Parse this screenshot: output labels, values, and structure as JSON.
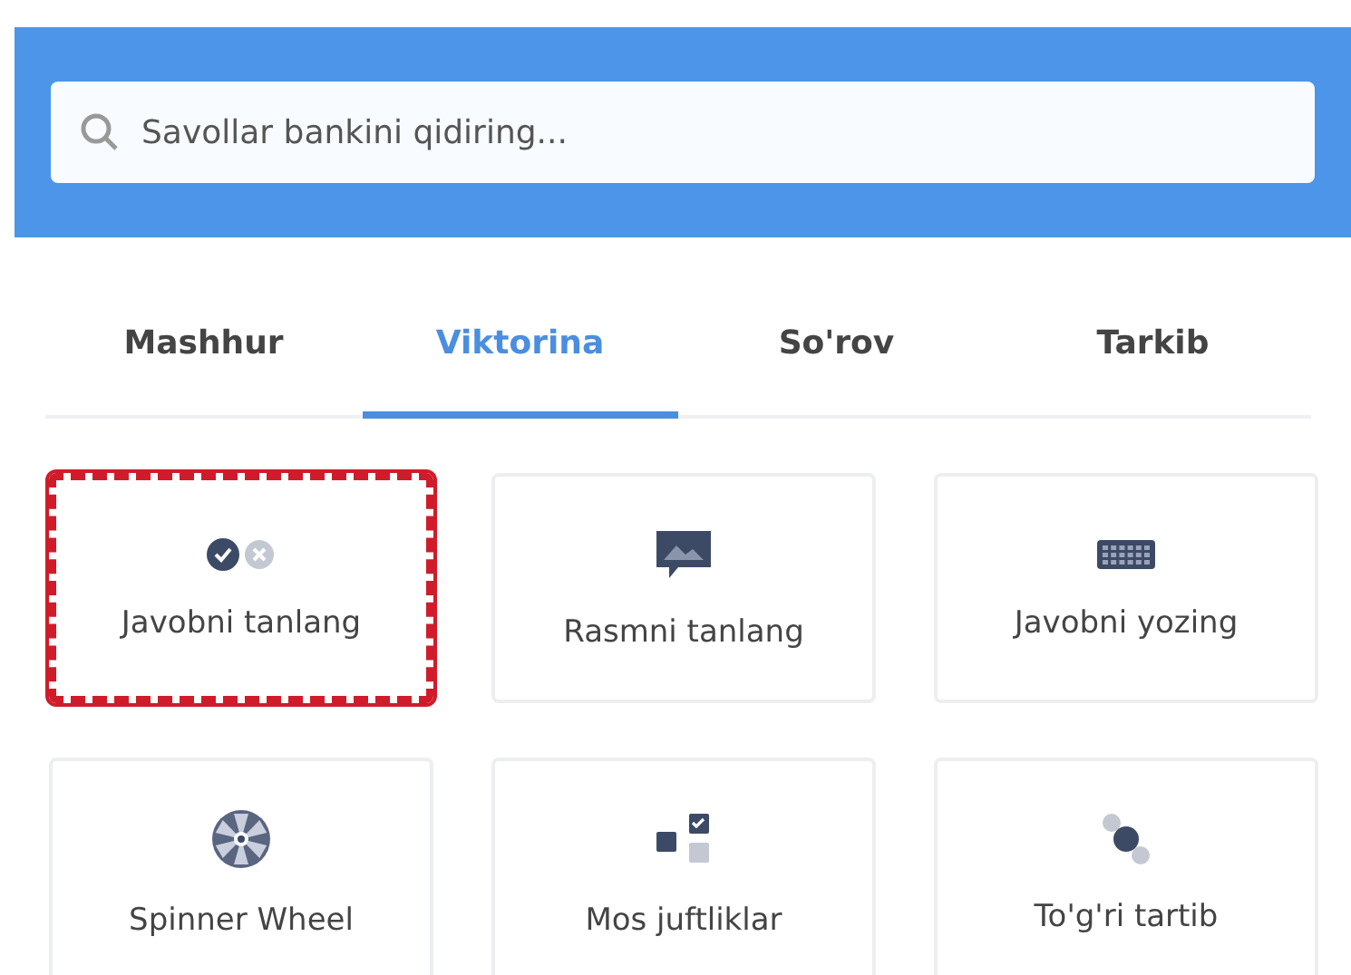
{
  "search": {
    "placeholder": "Savollar bankini qidiring..."
  },
  "tabs": [
    {
      "label": "Mashhur",
      "selected": false
    },
    {
      "label": "Viktorina",
      "selected": true
    },
    {
      "label": "So'rov",
      "selected": false
    },
    {
      "label": "Tarkib",
      "selected": false
    }
  ],
  "question_types": [
    {
      "kind": "choice",
      "label": "Javobni tanlang",
      "selected": true
    },
    {
      "kind": "image",
      "label": "Rasmni tanlang",
      "selected": false
    },
    {
      "kind": "keyboard",
      "label": "Javobni yozing",
      "selected": false
    },
    {
      "kind": "wheel",
      "label": "Spinner Wheel",
      "selected": false
    },
    {
      "kind": "match",
      "label": "Mos juftliklar",
      "selected": false
    },
    {
      "kind": "order",
      "label": "To'g'ri tartib",
      "selected": false
    }
  ]
}
